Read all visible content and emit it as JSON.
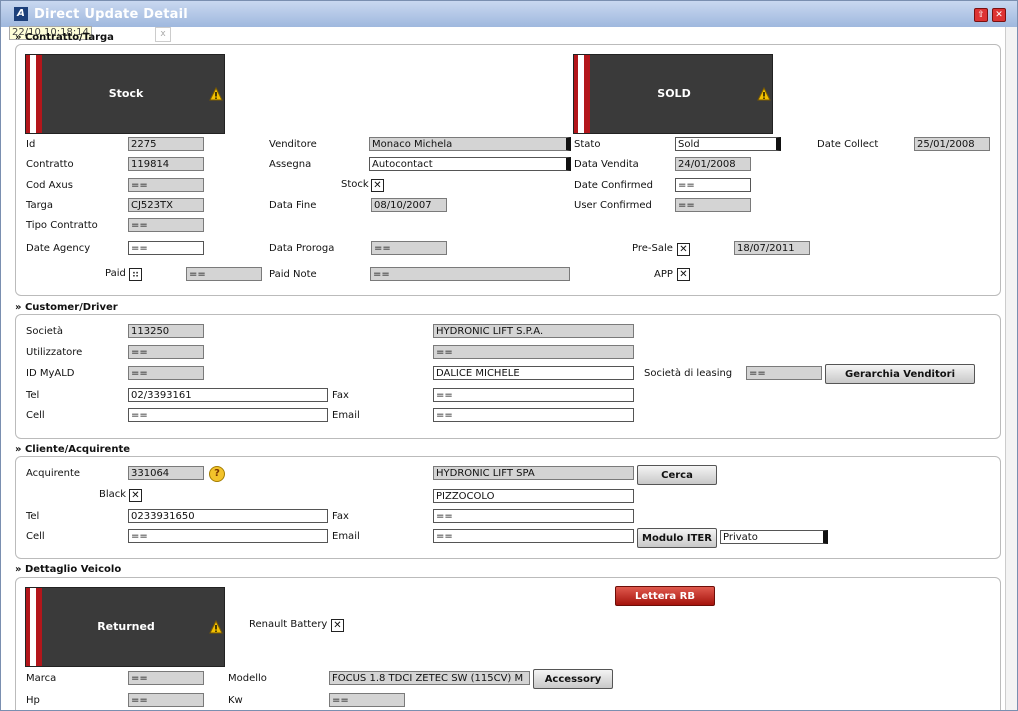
{
  "window": {
    "title": "Direct Update Detail",
    "timestamp": "22/10 10:18:14"
  },
  "contratto": {
    "title": "» Contratto/Targa",
    "banner_left": "Stock",
    "banner_right": "SOLD",
    "labels": {
      "id": "Id",
      "contratto": "Contratto",
      "cod_axus": "Cod Axus",
      "targa": "Targa",
      "tipo_contratto": "Tipo Contratto",
      "date_agency": "Date Agency",
      "paid": "Paid",
      "venditore": "Venditore",
      "assegna": "Assegna",
      "stock": "Stock",
      "data_fine": "Data Fine",
      "data_proroga": "Data Proroga",
      "paid_note": "Paid Note",
      "stato": "Stato",
      "data_vendita": "Data Vendita",
      "date_confirmed": "Date Confirmed",
      "user_confirmed": "User Confirmed",
      "pre_sale": "Pre-Sale",
      "app": "APP",
      "date_collect": "Date Collect"
    },
    "values": {
      "id": "2275",
      "contratto": "119814",
      "cod_axus": "==",
      "targa": "CJ523TX",
      "tipo_contratto": "==",
      "date_agency": "==",
      "paid": "==",
      "venditore": "Monaco Michela",
      "assegna": "Autocontact",
      "data_fine": "08/10/2007",
      "data_proroga": "==",
      "paid_note": "==",
      "stato": "Sold",
      "data_vendita": "24/01/2008",
      "date_confirmed": "==",
      "user_confirmed": "==",
      "pre_sale_date": "18/07/2011",
      "date_collect": "25/01/2008"
    }
  },
  "customer": {
    "title": "» Customer/Driver",
    "labels": {
      "societa": "Società",
      "utilizzatore": "Utilizzatore",
      "id_myald": "ID MyALD",
      "tel": "Tel",
      "cell": "Cell",
      "fax": "Fax",
      "email": "Email",
      "societa_leasing": "Società di leasing"
    },
    "values": {
      "societa": "113250",
      "societa_name": "HYDRONIC LIFT S.P.A.",
      "utilizzatore": "==",
      "utilizzatore_name": "==",
      "id_myald": "==",
      "driver_name": "DALICE MICHELE",
      "societa_leasing": "==",
      "tel": "02/3393161",
      "fax": "==",
      "cell": "==",
      "email": "=="
    },
    "button_gerarchia": "Gerarchia Venditori"
  },
  "cliente": {
    "title": "» Cliente/Acquirente",
    "labels": {
      "acquirente": "Acquirente",
      "black": "Black",
      "tel": "Tel",
      "cell": "Cell",
      "fax": "Fax",
      "email": "Email"
    },
    "values": {
      "acquirente": "331064",
      "acquirente_name": "HYDRONIC LIFT SPA",
      "address": "PIZZOCOLO",
      "tel": "0233931650",
      "fax": "==",
      "cell": "==",
      "email": "==",
      "tipo": "Privato"
    },
    "button_cerca": "Cerca",
    "button_modulo": "Modulo ITER"
  },
  "veicolo": {
    "title": "» Dettaglio Veicolo",
    "banner": "Returned",
    "button_lettera": "Lettera RB",
    "labels": {
      "renault_battery": "Renault Battery",
      "marca": "Marca",
      "modello": "Modello",
      "hp": "Hp",
      "kw": "Kw"
    },
    "values": {
      "marca": "==",
      "modello": "FOCUS 1.8 TDCI ZETEC SW (115CV) M",
      "hp": "==",
      "kw": "=="
    },
    "button_accessory": "Accessory"
  },
  "colors": {
    "accent_red": "#b3161b",
    "banner_dark": "#3a3a3a",
    "button_red": "#c0281c"
  }
}
